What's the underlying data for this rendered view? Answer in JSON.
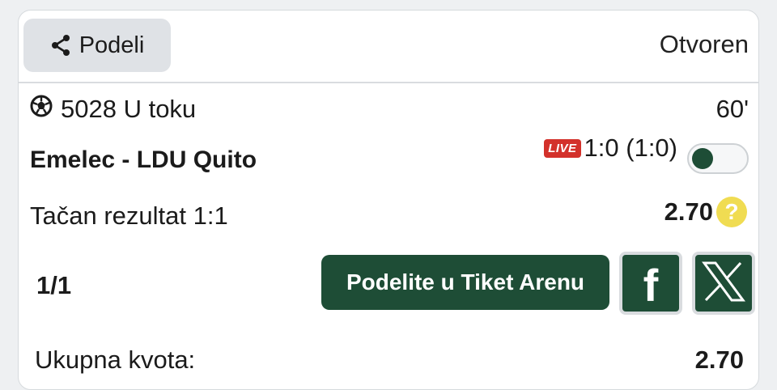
{
  "header": {
    "share_label": "Podeli",
    "status": "Otvoren"
  },
  "match": {
    "id_text": "5028 U toku",
    "minute": "60'",
    "teams": "Emelec - LDU Quito",
    "live_badge": "LIVE",
    "score": "1:0 (1:0)",
    "live_tracking_toggle": false
  },
  "bet": {
    "market": "Tačan rezultat 1:1",
    "odds": "2.70",
    "help_icon": "?"
  },
  "actions": {
    "count": "1/1",
    "arena_button_label": "Podelite u Tiket Arenu",
    "facebook_glyph": "f",
    "x_glyph": "X"
  },
  "totals": {
    "label": "Ukupna kvota:",
    "value": "2.70"
  },
  "colors": {
    "accent_green": "#1e4d36",
    "live_red": "#d3312b",
    "help_yellow": "#f0dc52"
  },
  "icons": [
    "share-icon",
    "soccer-ball-icon",
    "help-icon",
    "facebook-icon",
    "x-icon"
  ]
}
